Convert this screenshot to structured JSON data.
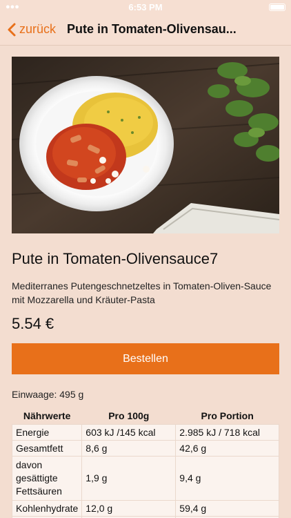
{
  "status_bar": {
    "time": "6:53 PM"
  },
  "navbar": {
    "back_label": "zurück",
    "title": "Pute in Tomaten-Olivensau..."
  },
  "product": {
    "image_icon": "food-photo",
    "title": "Pute in Tomaten-Olivensauce7",
    "description": "Mediterranes Putengeschnetzeltes in Tomaten-Oliven-Sauce mit Mozzarella und Kräuter-Pasta",
    "price": "5.54 €",
    "order_label": "Bestellen",
    "weight": "Einwaage: 495 g"
  },
  "nutrition": {
    "headers": [
      "Nährwerte",
      "Pro 100g",
      "Pro Portion"
    ],
    "rows": [
      {
        "name": "Energie",
        "per100": "603 kJ /145 kcal",
        "portion": "2.985 kJ / 718 kcal"
      },
      {
        "name": "Gesamtfett",
        "per100": "8,6 g",
        "portion": "42,6 g"
      },
      {
        "name": "davon gesättigte Fettsäuren",
        "per100": "1,9 g",
        "portion": "9,4 g"
      },
      {
        "name": "Kohlenhydrate",
        "per100": "12,0 g",
        "portion": "59,4 g"
      },
      {
        "name": "",
        "per100": "",
        "portion": ""
      }
    ]
  },
  "colors": {
    "accent": "#e8701a",
    "background": "#f3ddd0"
  }
}
